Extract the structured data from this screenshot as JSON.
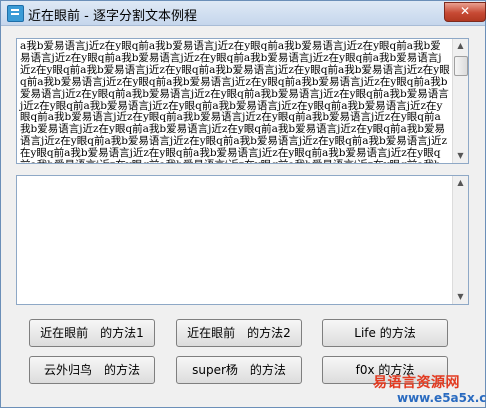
{
  "window": {
    "title": "近在眼前 - 逐字分割文本例程",
    "close_label": "✕"
  },
  "textbox1": {
    "value": "a我b爱易语言j近z在y眼q前a我b爱易语言j近z在y眼q前a我b爱易语言j近z在y眼q前a我b爱易语言j近z在y眼q前a我b爱易语言j近z在y眼q前a我b爱易语言j近z在y眼q前a我b爱易语言j近z在y眼q前a我b爱易语言j近z在y眼q前a我b爱易语言j近z在y眼q前a我b爱易语言j近z在y眼q前a我b爱易语言j近z在y眼q前a我b爱易语言j近z在y眼q前a我b爱易语言j近z在y眼q前a我b爱易语言j近z在y眼q前a我b爱易语言j近z在y眼q前a我b爱易语言j近z在y眼q前a我b爱易语言j近z在y眼q前a我b爱易语言j近z在y眼q前a我b爱易语言j近z在y眼q前a我b爱易语言j近z在y眼q前a我b爱易语言j近z在y眼q前a我b爱易语言j近z在y眼q前a我b爱易语言j近z在y眼q前a我b爱易语言j近z在y眼q前a我b爱易语言j近z在y眼q前a我b爱易语言j近z在y眼q前a我b爱易语言j近z在y眼q前a我b爱易语言j近z在y眼q前a我b爱易语言j近z在y眼q前a我b爱易语言j近z在y眼q前a我b爱易语言j近z在y眼q前a我b爱易语言j近z在y眼q前a我b爱易语言j近z在y眼q前a我b爱易语言j近z在y眼q前a我b爱易语言j近z在y眼q前a我b爱易语言j近z在y眼q前a我b爱易语言j近z在y眼q前a我b爱易语言j近z在y眼q前a我b爱易语言j近z在y眼q前a我b爱易语言j近z在y眼q前a我b爱易语言j近z在y眼q前a我b爱易语言j近z在y眼q前a我b爱易语言j近z在y眼q前a我b爱易语言j近z在y眼q前a我b爱易语言j近z在y眼q前a我b爱易"
  },
  "textbox2": {
    "value": ""
  },
  "buttons": {
    "b1": "近在眼前　的方法1",
    "b2": "近在眼前　的方法2",
    "b3": "Life 的方法",
    "b4": "云外归鸟　的方法",
    "b5": "super杨　的方法",
    "b6": "f0x 的方法"
  },
  "watermark": {
    "text": "易语言资源网",
    "url": "www.e5a5x.com"
  }
}
